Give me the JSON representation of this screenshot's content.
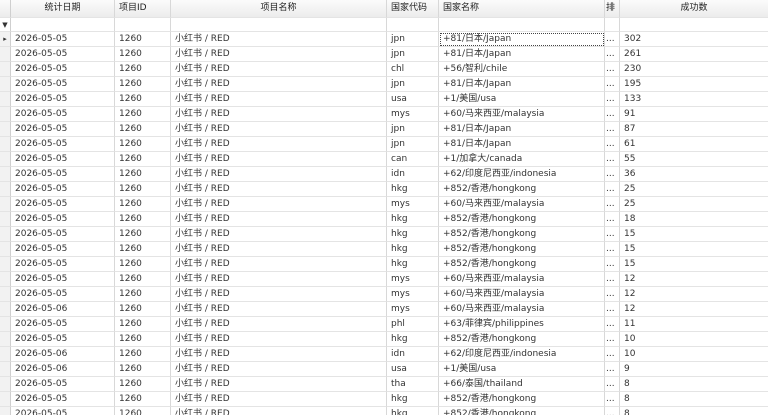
{
  "columns": [
    "统计日期",
    "项目ID",
    "项目名称",
    "国家代码",
    "国家名称",
    "排",
    "成功数"
  ],
  "filter_icon": "filter-funnel-icon",
  "row_indicator_icon": "current-row-arrow-icon",
  "rows": [
    {
      "date": "2026-05-05",
      "pid": "1260",
      "pname": "小红书 / RED",
      "code": "jpn",
      "cname": "+81/日本/Japan",
      "extra": "...",
      "count": "302"
    },
    {
      "date": "2026-05-05",
      "pid": "1260",
      "pname": "小红书 / RED",
      "code": "jpn",
      "cname": "+81/日本/Japan",
      "extra": "...",
      "count": "261"
    },
    {
      "date": "2026-05-05",
      "pid": "1260",
      "pname": "小红书 / RED",
      "code": "chl",
      "cname": "+56/智利/chile",
      "extra": "...",
      "count": "230"
    },
    {
      "date": "2026-05-05",
      "pid": "1260",
      "pname": "小红书 / RED",
      "code": "jpn",
      "cname": "+81/日本/Japan",
      "extra": "...",
      "count": "195"
    },
    {
      "date": "2026-05-05",
      "pid": "1260",
      "pname": "小红书 / RED",
      "code": "usa",
      "cname": "+1/美国/usa",
      "extra": "...",
      "count": "133"
    },
    {
      "date": "2026-05-05",
      "pid": "1260",
      "pname": "小红书 / RED",
      "code": "mys",
      "cname": "+60/马来西亚/malaysia",
      "extra": "...",
      "count": "91"
    },
    {
      "date": "2026-05-05",
      "pid": "1260",
      "pname": "小红书 / RED",
      "code": "jpn",
      "cname": "+81/日本/Japan",
      "extra": "...",
      "count": "87"
    },
    {
      "date": "2026-05-05",
      "pid": "1260",
      "pname": "小红书 / RED",
      "code": "jpn",
      "cname": "+81/日本/Japan",
      "extra": "...",
      "count": "61"
    },
    {
      "date": "2026-05-05",
      "pid": "1260",
      "pname": "小红书 / RED",
      "code": "can",
      "cname": "+1/加拿大/canada",
      "extra": "...",
      "count": "55"
    },
    {
      "date": "2026-05-05",
      "pid": "1260",
      "pname": "小红书 / RED",
      "code": "idn",
      "cname": "+62/印度尼西亚/indonesia",
      "extra": "...",
      "count": "36"
    },
    {
      "date": "2026-05-05",
      "pid": "1260",
      "pname": "小红书 / RED",
      "code": "hkg",
      "cname": "+852/香港/hongkong",
      "extra": "...",
      "count": "25"
    },
    {
      "date": "2026-05-05",
      "pid": "1260",
      "pname": "小红书 / RED",
      "code": "mys",
      "cname": "+60/马来西亚/malaysia",
      "extra": "...",
      "count": "25"
    },
    {
      "date": "2026-05-05",
      "pid": "1260",
      "pname": "小红书 / RED",
      "code": "hkg",
      "cname": "+852/香港/hongkong",
      "extra": "...",
      "count": "18"
    },
    {
      "date": "2026-05-05",
      "pid": "1260",
      "pname": "小红书 / RED",
      "code": "hkg",
      "cname": "+852/香港/hongkong",
      "extra": "...",
      "count": "15"
    },
    {
      "date": "2026-05-05",
      "pid": "1260",
      "pname": "小红书 / RED",
      "code": "hkg",
      "cname": "+852/香港/hongkong",
      "extra": "...",
      "count": "15"
    },
    {
      "date": "2026-05-05",
      "pid": "1260",
      "pname": "小红书 / RED",
      "code": "hkg",
      "cname": "+852/香港/hongkong",
      "extra": "...",
      "count": "15"
    },
    {
      "date": "2026-05-05",
      "pid": "1260",
      "pname": "小红书 / RED",
      "code": "mys",
      "cname": "+60/马来西亚/malaysia",
      "extra": "...",
      "count": "12"
    },
    {
      "date": "2026-05-05",
      "pid": "1260",
      "pname": "小红书 / RED",
      "code": "mys",
      "cname": "+60/马来西亚/malaysia",
      "extra": "...",
      "count": "12"
    },
    {
      "date": "2026-05-06",
      "pid": "1260",
      "pname": "小红书 / RED",
      "code": "mys",
      "cname": "+60/马来西亚/malaysia",
      "extra": "...",
      "count": "12"
    },
    {
      "date": "2026-05-05",
      "pid": "1260",
      "pname": "小红书 / RED",
      "code": "phl",
      "cname": "+63/菲律宾/philippines",
      "extra": "...",
      "count": "11"
    },
    {
      "date": "2026-05-05",
      "pid": "1260",
      "pname": "小红书 / RED",
      "code": "hkg",
      "cname": "+852/香港/hongkong",
      "extra": "...",
      "count": "10"
    },
    {
      "date": "2026-05-06",
      "pid": "1260",
      "pname": "小红书 / RED",
      "code": "idn",
      "cname": "+62/印度尼西亚/indonesia",
      "extra": "...",
      "count": "10"
    },
    {
      "date": "2026-05-06",
      "pid": "1260",
      "pname": "小红书 / RED",
      "code": "usa",
      "cname": "+1/美国/usa",
      "extra": "...",
      "count": "9"
    },
    {
      "date": "2026-05-05",
      "pid": "1260",
      "pname": "小红书 / RED",
      "code": "tha",
      "cname": "+66/泰国/thailand",
      "extra": "...",
      "count": "8"
    },
    {
      "date": "2026-05-05",
      "pid": "1260",
      "pname": "小红书 / RED",
      "code": "hkg",
      "cname": "+852/香港/hongkong",
      "extra": "...",
      "count": "8"
    },
    {
      "date": "2026-05-05",
      "pid": "1260",
      "pname": "小红书 / RED",
      "code": "hkg",
      "cname": "+852/香港/hongkong",
      "extra": "...",
      "count": "8"
    }
  ]
}
